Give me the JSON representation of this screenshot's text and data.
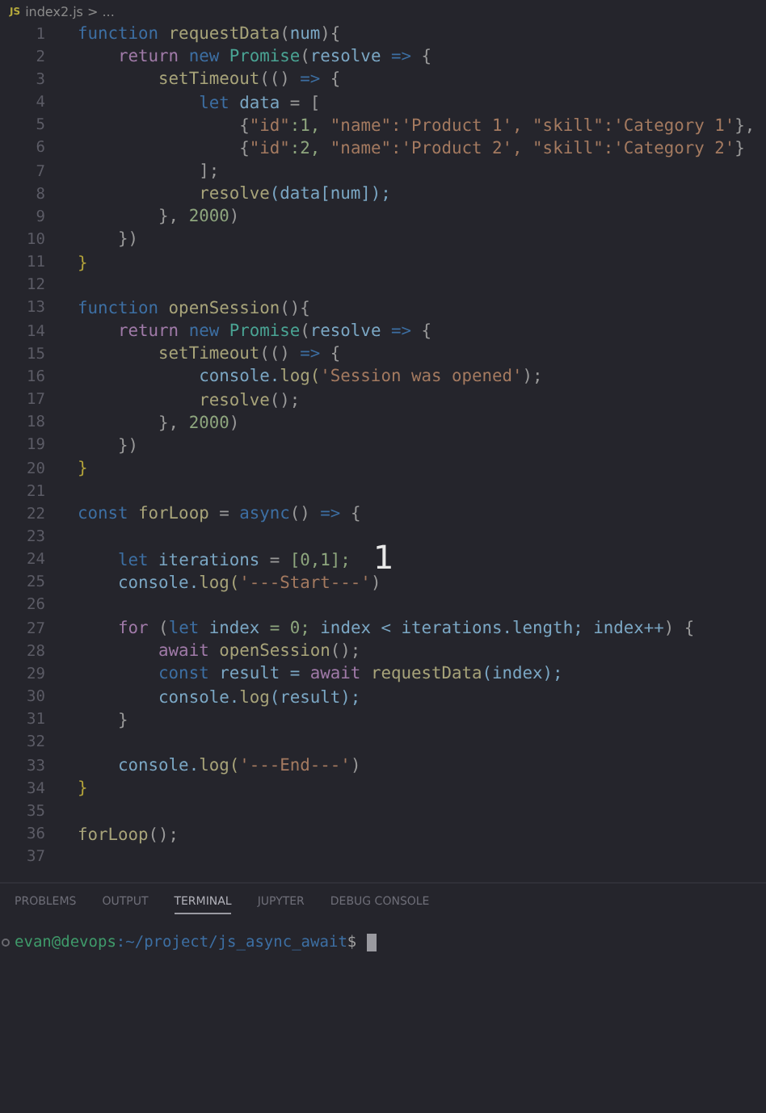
{
  "breadcrumb": {
    "icon": "JS",
    "file": "index2.js",
    "rest": "> ..."
  },
  "editor": {
    "lines": [
      {
        "n": "1",
        "tokens": [
          {
            "kind": "kw",
            "t": "function"
          },
          {
            "kind": "fn",
            "t": " requestData"
          },
          {
            "kind": "p",
            "t": "("
          },
          {
            "kind": "var",
            "t": "num"
          },
          {
            "kind": "p",
            "t": "){"
          }
        ]
      },
      {
        "n": "2",
        "tokens": [
          {
            "kind": "ctl",
            "t": "    return"
          },
          {
            "kind": "kw",
            "t": " new"
          },
          {
            "kind": "cls",
            "t": " Promise"
          },
          {
            "kind": "p",
            "t": "("
          },
          {
            "kind": "var",
            "t": "resolve"
          },
          {
            "kind": "kw",
            "t": " =>"
          },
          {
            "kind": "p",
            "t": " {"
          }
        ]
      },
      {
        "n": "3",
        "tokens": [
          {
            "kind": "fn",
            "t": "        setTimeout"
          },
          {
            "kind": "p",
            "t": "(()"
          },
          {
            "kind": "kw",
            "t": " =>"
          },
          {
            "kind": "p",
            "t": " {"
          }
        ]
      },
      {
        "n": "4",
        "tokens": [
          {
            "kind": "kw",
            "t": "            let"
          },
          {
            "kind": "var",
            "t": " data"
          },
          {
            "kind": "p",
            "t": " = ["
          }
        ]
      },
      {
        "n": "5",
        "tokens": [
          {
            "kind": "p",
            "t": "                {"
          },
          {
            "kind": "str",
            "t": "\"id\""
          },
          {
            "kind": "num",
            "t": ":1,"
          },
          {
            "kind": "str",
            "t": " \"name\":'Product 1',"
          },
          {
            "kind": "str",
            "t": " \"skill\":'Category 1'"
          },
          {
            "kind": "p",
            "t": "},"
          }
        ]
      },
      {
        "n": "6",
        "tokens": [
          {
            "kind": "p",
            "t": "                {"
          },
          {
            "kind": "str",
            "t": "\"id\""
          },
          {
            "kind": "num",
            "t": ":2,"
          },
          {
            "kind": "str",
            "t": " \"name\":'Product 2',"
          },
          {
            "kind": "str",
            "t": " \"skill\":'Category 2'"
          },
          {
            "kind": "p",
            "t": "}"
          }
        ]
      },
      {
        "n": "7",
        "tokens": [
          {
            "kind": "p",
            "t": "            ];"
          }
        ]
      },
      {
        "n": "8",
        "tokens": [
          {
            "kind": "fn",
            "t": "            resolve"
          },
          {
            "kind": "var",
            "t": "(data[num]);"
          }
        ]
      },
      {
        "n": "9",
        "tokens": [
          {
            "kind": "p",
            "t": "        },"
          },
          {
            "kind": "num",
            "t": " 2000"
          },
          {
            "kind": "p",
            "t": ")"
          }
        ]
      },
      {
        "n": "10",
        "tokens": [
          {
            "kind": "p",
            "t": "    })"
          }
        ]
      },
      {
        "n": "11",
        "tokens": [
          {
            "kind": "br",
            "t": "}"
          }
        ]
      },
      {
        "n": "12"
      },
      {
        "n": "13",
        "tokens": [
          {
            "kind": "kw",
            "t": "function"
          },
          {
            "kind": "fn",
            "t": " openSession"
          },
          {
            "kind": "p",
            "t": "(){"
          }
        ]
      },
      {
        "n": "14",
        "tokens": [
          {
            "kind": "ctl",
            "t": "    return"
          },
          {
            "kind": "kw",
            "t": " new"
          },
          {
            "kind": "cls",
            "t": " Promise"
          },
          {
            "kind": "p",
            "t": "("
          },
          {
            "kind": "var",
            "t": "resolve"
          },
          {
            "kind": "kw",
            "t": " =>"
          },
          {
            "kind": "p",
            "t": " {"
          }
        ]
      },
      {
        "n": "15",
        "tokens": [
          {
            "kind": "fn",
            "t": "        setTimeout"
          },
          {
            "kind": "p",
            "t": "(()"
          },
          {
            "kind": "kw",
            "t": " =>"
          },
          {
            "kind": "p",
            "t": " {"
          }
        ]
      },
      {
        "n": "16",
        "tokens": [
          {
            "kind": "var",
            "t": "            console."
          },
          {
            "kind": "fn",
            "t": "log("
          },
          {
            "kind": "str",
            "t": "'Session was opened'"
          },
          {
            "kind": "p",
            "t": ");"
          }
        ]
      },
      {
        "n": "17",
        "tokens": [
          {
            "kind": "fn",
            "t": "            resolve"
          },
          {
            "kind": "p",
            "t": "();"
          }
        ]
      },
      {
        "n": "18",
        "tokens": [
          {
            "kind": "p",
            "t": "        },"
          },
          {
            "kind": "num",
            "t": " 2000"
          },
          {
            "kind": "p",
            "t": ")"
          }
        ]
      },
      {
        "n": "19",
        "tokens": [
          {
            "kind": "p",
            "t": "    })"
          }
        ]
      },
      {
        "n": "20",
        "tokens": [
          {
            "kind": "br",
            "t": "}"
          }
        ]
      },
      {
        "n": "21"
      },
      {
        "n": "22",
        "tokens": [
          {
            "kind": "kw",
            "t": "const"
          },
          {
            "kind": "fn",
            "t": " forLoop"
          },
          {
            "kind": "p",
            "t": " ="
          },
          {
            "kind": "kw",
            "t": " async"
          },
          {
            "kind": "p",
            "t": "()"
          },
          {
            "kind": "kw",
            "t": " =>"
          },
          {
            "kind": "p",
            "t": " {"
          }
        ]
      },
      {
        "n": "23"
      },
      {
        "n": "24",
        "tokens": [
          {
            "kind": "kw",
            "t": "    let"
          },
          {
            "kind": "var",
            "t": " iterations"
          },
          {
            "kind": "p",
            "t": " ="
          },
          {
            "kind": "num",
            "t": " [0,1];"
          }
        ]
      },
      {
        "n": "25",
        "tokens": [
          {
            "kind": "var",
            "t": "    console."
          },
          {
            "kind": "fn",
            "t": "log("
          },
          {
            "kind": "str",
            "t": "'---Start---'"
          },
          {
            "kind": "p",
            "t": ")"
          }
        ]
      },
      {
        "n": "26"
      },
      {
        "n": "27",
        "tokens": [
          {
            "kind": "ctl",
            "t": "    for"
          },
          {
            "kind": "p",
            "t": " ("
          },
          {
            "kind": "kw",
            "t": "let"
          },
          {
            "kind": "var",
            "t": " index"
          },
          {
            "kind": "num",
            "t": " = 0;"
          },
          {
            "kind": "var",
            "t": " index < iterations.length; index++"
          },
          {
            "kind": "p",
            "t": ") {"
          }
        ]
      },
      {
        "n": "28",
        "tokens": [
          {
            "kind": "ctl",
            "t": "        await"
          },
          {
            "kind": "fn",
            "t": " openSession"
          },
          {
            "kind": "p",
            "t": "();"
          }
        ]
      },
      {
        "n": "29",
        "tokens": [
          {
            "kind": "kw",
            "t": "        const"
          },
          {
            "kind": "var",
            "t": " result ="
          },
          {
            "kind": "ctl",
            "t": " await"
          },
          {
            "kind": "fn",
            "t": " requestData"
          },
          {
            "kind": "var",
            "t": "(index);"
          }
        ]
      },
      {
        "n": "30",
        "tokens": [
          {
            "kind": "var",
            "t": "        console."
          },
          {
            "kind": "fn",
            "t": "log"
          },
          {
            "kind": "var",
            "t": "(result);"
          }
        ]
      },
      {
        "n": "31",
        "tokens": [
          {
            "kind": "p",
            "t": "    }"
          }
        ]
      },
      {
        "n": "32"
      },
      {
        "n": "33",
        "tokens": [
          {
            "kind": "var",
            "t": "    console."
          },
          {
            "kind": "fn",
            "t": "log("
          },
          {
            "kind": "str",
            "t": "'---End---'"
          },
          {
            "kind": "p",
            "t": ")"
          }
        ]
      },
      {
        "n": "34",
        "tokens": [
          {
            "kind": "br",
            "t": "}"
          }
        ]
      },
      {
        "n": "35"
      },
      {
        "n": "36",
        "tokens": [
          {
            "kind": "fn",
            "t": "forLoop"
          },
          {
            "kind": "p",
            "t": "();"
          }
        ]
      },
      {
        "n": "37"
      }
    ]
  },
  "overlay_counter": "1",
  "panel_tabs": [
    {
      "label": "PROBLEMS",
      "selected": false
    },
    {
      "label": "OUTPUT",
      "selected": false
    },
    {
      "label": "TERMINAL",
      "selected": true
    },
    {
      "label": "JUPYTER",
      "selected": false
    },
    {
      "label": "DEBUG CONSOLE",
      "selected": false
    }
  ],
  "terminal": {
    "user": "evan@devops",
    "path": ":~/project/js_async_await",
    "symbol": "$"
  }
}
